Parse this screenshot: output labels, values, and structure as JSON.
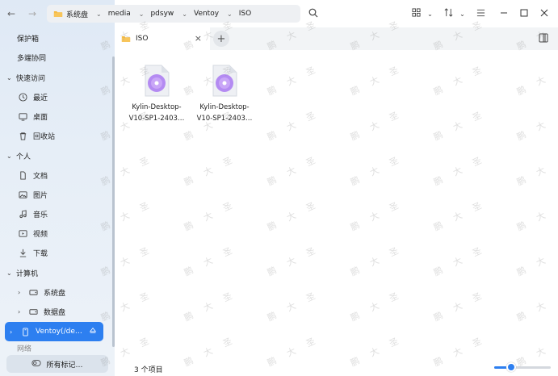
{
  "breadcrumb": [
    "系统盘",
    "media",
    "pdsyw",
    "Ventoy",
    "ISO"
  ],
  "sidebar": {
    "items_top": [
      "保护箱",
      "多端协同"
    ],
    "quick_access": {
      "label": "快速访问",
      "items": [
        "最近",
        "桌面",
        "回收站"
      ]
    },
    "personal": {
      "label": "个人",
      "items": [
        "文档",
        "图片",
        "音乐",
        "视频",
        "下载"
      ]
    },
    "computer": {
      "label": "计算机",
      "items": [
        "系统盘",
        "数据盘",
        "Ventoy(/de…"
      ]
    },
    "network_label": "网络",
    "tags_button": "所有标记…"
  },
  "tab": {
    "label": "ISO"
  },
  "files": [
    {
      "name_line1": "Kylin-Desktop-",
      "name_line2": "V10-SP1-2403…"
    },
    {
      "name_line1": "Kylin-Desktop-",
      "name_line2": "V10-SP1-2403…"
    }
  ],
  "status": {
    "count_text": "3 个项目"
  },
  "zoom": {
    "level": 0.25
  },
  "colors": {
    "accent": "#2d7ff0",
    "folder": "#f5b73b"
  },
  "watermark_chars": [
    "鹏",
    "大",
    "圣"
  ]
}
